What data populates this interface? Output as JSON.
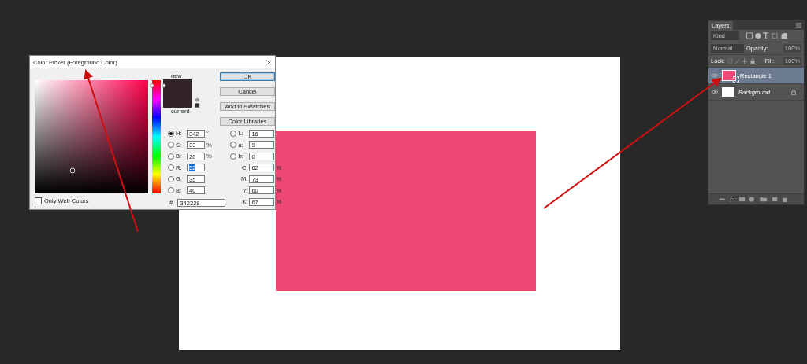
{
  "dialog": {
    "title": "Color Picker (Foreground Color)",
    "new_label": "new",
    "current_label": "current",
    "buttons": [
      {
        "label": "OK",
        "default": true
      },
      {
        "label": "Cancel",
        "default": false
      },
      {
        "label": "Add to Swatches",
        "default": false
      },
      {
        "label": "Color Libraries",
        "default": false
      }
    ],
    "left_fields": [
      {
        "label": "H:",
        "value": "342",
        "unit": "°",
        "selected": true,
        "highlighted": false
      },
      {
        "label": "S:",
        "value": "33",
        "unit": "%",
        "selected": false,
        "highlighted": false
      },
      {
        "label": "B:",
        "value": "20",
        "unit": "%",
        "selected": false,
        "highlighted": false
      },
      {
        "label": "R:",
        "value": "52",
        "selected": false,
        "highlighted": true
      },
      {
        "label": "G:",
        "value": "35",
        "selected": false,
        "highlighted": false
      },
      {
        "label": "B:",
        "value": "40",
        "selected": false,
        "highlighted": false
      }
    ],
    "right_fields": [
      {
        "kind": "radio",
        "label": "L:",
        "value": "16",
        "selected": false
      },
      {
        "kind": "radio",
        "label": "a:",
        "value": "9",
        "selected": false
      },
      {
        "kind": "radio",
        "label": "b:",
        "value": "0",
        "selected": false
      },
      {
        "kind": "plain",
        "label": "C:",
        "value": "62",
        "unit": "%"
      },
      {
        "kind": "plain",
        "label": "M:",
        "value": "73",
        "unit": "%"
      },
      {
        "kind": "plain",
        "label": "Y:",
        "value": "60",
        "unit": "%"
      },
      {
        "kind": "plain",
        "label": "K:",
        "value": "67",
        "unit": "%"
      }
    ],
    "hue_slider": {
      "level": 0.95
    },
    "hex_label": "#",
    "hex": "342328",
    "only_web_colors": {
      "label": "Only Web Colors",
      "checked": false
    }
  },
  "layers_panel": {
    "title": "Layers",
    "filter": "Kind",
    "blend_mode": "Normal",
    "opacity_label": "Opacity:",
    "opacity": "100%",
    "lock_label": "Lock:",
    "fill_label": "Fill:",
    "fill": "100%",
    "layers": [
      {
        "name": "Rectangle 1",
        "kind": "shape",
        "selected": true,
        "visible": true,
        "locked": false
      },
      {
        "name": "Background",
        "kind": "background",
        "selected": false,
        "visible": true,
        "locked": true
      }
    ]
  }
}
